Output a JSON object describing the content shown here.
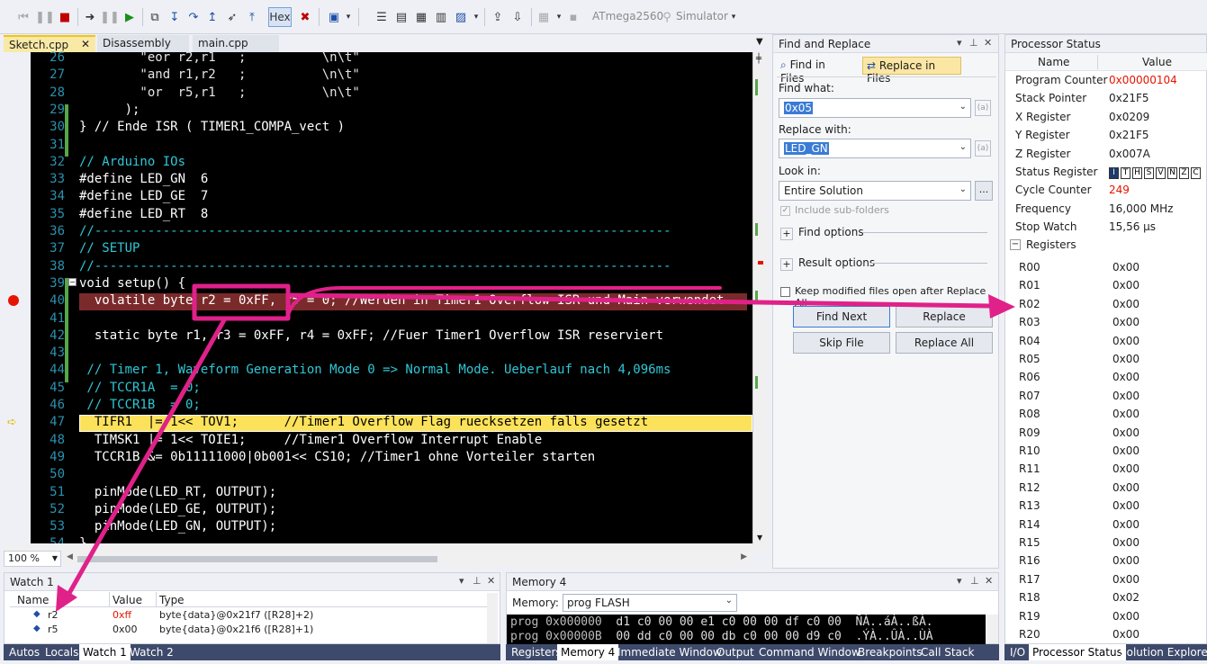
{
  "toolbar": {
    "hex_label": "Hex",
    "device_label": "ATmega2560",
    "simulator_label": "Simulator"
  },
  "editor": {
    "tabs": [
      {
        "label": "Sketch.cpp",
        "active": true
      },
      {
        "label": "Disassembly",
        "active": false
      },
      {
        "label": "main.cpp",
        "active": false
      }
    ],
    "zoom": "100 %",
    "lines": [
      {
        "n": "26",
        "text": "        \"eor r2,r1   ;          \\n\\t\""
      },
      {
        "n": "27",
        "text": "        \"and r1,r2   ;          \\n\\t\""
      },
      {
        "n": "28",
        "text": "        \"or  r5,r1   ;          \\n\\t\""
      },
      {
        "n": "29",
        "text": "      );"
      },
      {
        "n": "30",
        "text": "} // Ende ISR ( TIMER1_COMPA_vect )"
      },
      {
        "n": "31",
        "text": ""
      },
      {
        "n": "32",
        "text": "// Arduino IOs"
      },
      {
        "n": "33",
        "text": "#define LED_GN  6"
      },
      {
        "n": "34",
        "text": "#define LED_GE  7"
      },
      {
        "n": "35",
        "text": "#define LED_RT  8"
      },
      {
        "n": "36",
        "text": "//----------------------------------------------------------------------------"
      },
      {
        "n": "37",
        "text": "// SETUP"
      },
      {
        "n": "38",
        "text": "//----------------------------------------------------------------------------"
      },
      {
        "n": "39",
        "text": "void setup() {"
      },
      {
        "n": "40",
        "text": "  volatile byte r2 = 0xFF, r5 = 0; //Werden in Timer1 Overflow ISR und Main verwendet"
      },
      {
        "n": "41",
        "text": ""
      },
      {
        "n": "42",
        "text": "  static byte r1, r3 = 0xFF, r4 = 0xFF; //Fuer Timer1 Overflow ISR reserviert"
      },
      {
        "n": "43",
        "text": ""
      },
      {
        "n": "44",
        "text": " // Timer 1, Waveform Generation Mode 0 => Normal Mode. Ueberlauf nach 4,096ms"
      },
      {
        "n": "45",
        "text": " // TCCR1A  = 0;"
      },
      {
        "n": "46",
        "text": " // TCCR1B  = 0;"
      },
      {
        "n": "47",
        "text": "  TIFR1  |= 1<< TOV1;      //Timer1 Overflow Flag ruecksetzen falls gesetzt"
      },
      {
        "n": "48",
        "text": "  TIMSK1 |= 1<< TOIE1;     //Timer1 Overflow Interrupt Enable"
      },
      {
        "n": "49",
        "text": "  TCCR1B &= 0b11111000|0b001<< CS10; //Timer1 ohne Vorteiler starten"
      },
      {
        "n": "50",
        "text": ""
      },
      {
        "n": "51",
        "text": "  pinMode(LED_RT, OUTPUT);"
      },
      {
        "n": "52",
        "text": "  pinMode(LED_GE, OUTPUT);"
      },
      {
        "n": "53",
        "text": "  pinMode(LED_GN, OUTPUT);"
      },
      {
        "n": "54",
        "text": "}"
      }
    ]
  },
  "find_replace": {
    "title": "Find and Replace",
    "tab_find": "Find in Files",
    "tab_replace": "Replace in Files",
    "find_label": "Find what:",
    "find_value": "0x05",
    "replace_label": "Replace with:",
    "replace_value": "LED_GN",
    "lookin_label": "Look in:",
    "lookin_value": "Entire Solution",
    "include_sub": "Include sub-folders",
    "find_options": "Find options",
    "result_options": "Result options",
    "keep_modified": "Keep modified files open after Replace All",
    "btn_find_next": "Find Next",
    "btn_replace": "Replace",
    "btn_skip": "Skip File",
    "btn_replace_all": "Replace All"
  },
  "processor": {
    "title": "Processor Status",
    "col_name": "Name",
    "col_value": "Value",
    "rows": [
      {
        "name": "Program Counter",
        "value": "0x00000104",
        "red": true
      },
      {
        "name": "Stack Pointer",
        "value": "0x21F5",
        "red": false
      },
      {
        "name": "X Register",
        "value": "0x0209",
        "red": false
      },
      {
        "name": "Y Register",
        "value": "0x21F5",
        "red": false
      },
      {
        "name": "Z Register",
        "value": "0x007A",
        "red": false
      },
      {
        "name": "Status Register",
        "value": "",
        "red": false
      },
      {
        "name": "Cycle Counter",
        "value": "249",
        "red": true
      },
      {
        "name": "Frequency",
        "value": "16,000 MHz",
        "red": false
      },
      {
        "name": "Stop Watch",
        "value": "15,56 µs",
        "red": false
      }
    ],
    "sreg_flags": [
      "I",
      "T",
      "H",
      "S",
      "V",
      "N",
      "Z",
      "C"
    ],
    "registers_label": "Registers",
    "registers": [
      {
        "name": "R00",
        "value": "0x00"
      },
      {
        "name": "R01",
        "value": "0x00"
      },
      {
        "name": "R02",
        "value": "0x00"
      },
      {
        "name": "R03",
        "value": "0x00"
      },
      {
        "name": "R04",
        "value": "0x00"
      },
      {
        "name": "R05",
        "value": "0x00"
      },
      {
        "name": "R06",
        "value": "0x00"
      },
      {
        "name": "R07",
        "value": "0x00"
      },
      {
        "name": "R08",
        "value": "0x00"
      },
      {
        "name": "R09",
        "value": "0x00"
      },
      {
        "name": "R10",
        "value": "0x00"
      },
      {
        "name": "R11",
        "value": "0x00"
      },
      {
        "name": "R12",
        "value": "0x00"
      },
      {
        "name": "R13",
        "value": "0x00"
      },
      {
        "name": "R14",
        "value": "0x00"
      },
      {
        "name": "R15",
        "value": "0x00"
      },
      {
        "name": "R16",
        "value": "0x00"
      },
      {
        "name": "R17",
        "value": "0x00"
      },
      {
        "name": "R18",
        "value": "0x02"
      },
      {
        "name": "R19",
        "value": "0x00"
      },
      {
        "name": "R20",
        "value": "0x00"
      }
    ]
  },
  "watch": {
    "title": "Watch 1",
    "col_name": "Name",
    "col_value": "Value",
    "col_type": "Type",
    "rows": [
      {
        "name": "r2",
        "value": "0xff",
        "type": "byte{data}@0x21f7 ([R28]+2)",
        "red": true
      },
      {
        "name": "r5",
        "value": "0x00",
        "type": "byte{data}@0x21f6 ([R28]+1)",
        "red": false
      }
    ],
    "tabs": [
      "Autos",
      "Locals",
      "Watch 1",
      "Watch 2"
    ]
  },
  "memory": {
    "title": "Memory 4",
    "memory_label": "Memory:",
    "memory_value": "prog FLASH",
    "line1_addr": "prog 0x000000",
    "line1_bytes": "d1 c0 00 00 e1 c0 00 00 df c0 00",
    "line1_ascii": "ÑÀ..áÀ..ßÀ.",
    "line2_addr": "prog 0x00000B",
    "line2_bytes": "00 dd c0 00 00 db c0 00 00 d9 c0",
    "line2_ascii": ".ÝÀ..ÛÀ..ÙÀ",
    "tabs": [
      "Registers",
      "Memory 4",
      "Immediate Window",
      "Output",
      "Command Window",
      "Breakpoints",
      "Call Stack"
    ]
  },
  "right_tabs": [
    "I/O",
    "Processor Status",
    "Solution Explorer"
  ],
  "colors": {
    "annotation": "#e0218a",
    "accent": "#3d4a6b",
    "breakpoint": "#e51400",
    "highlight": "#fce25a"
  }
}
